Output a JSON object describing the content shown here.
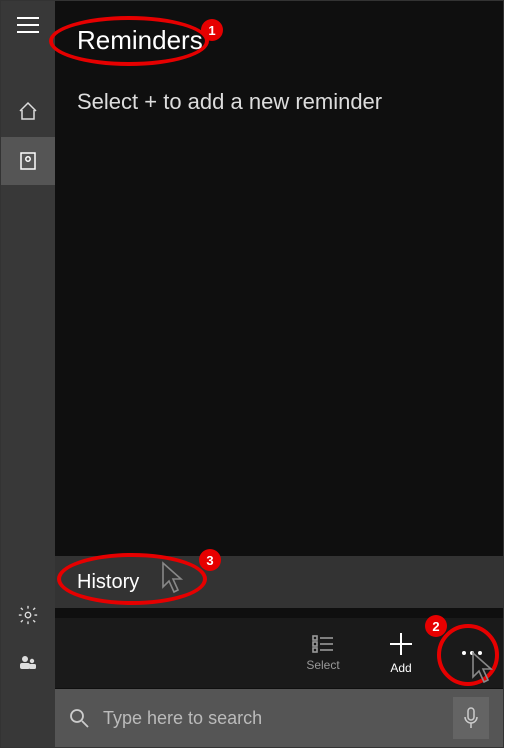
{
  "header": {
    "title": "Reminders"
  },
  "main": {
    "hint": "Select + to add a new reminder"
  },
  "popup": {
    "history": "History"
  },
  "commands": {
    "select": "Select",
    "add": "Add"
  },
  "search": {
    "placeholder": "Type here to search"
  },
  "annotations": {
    "badge1": "1",
    "badge2": "2",
    "badge3": "3"
  }
}
